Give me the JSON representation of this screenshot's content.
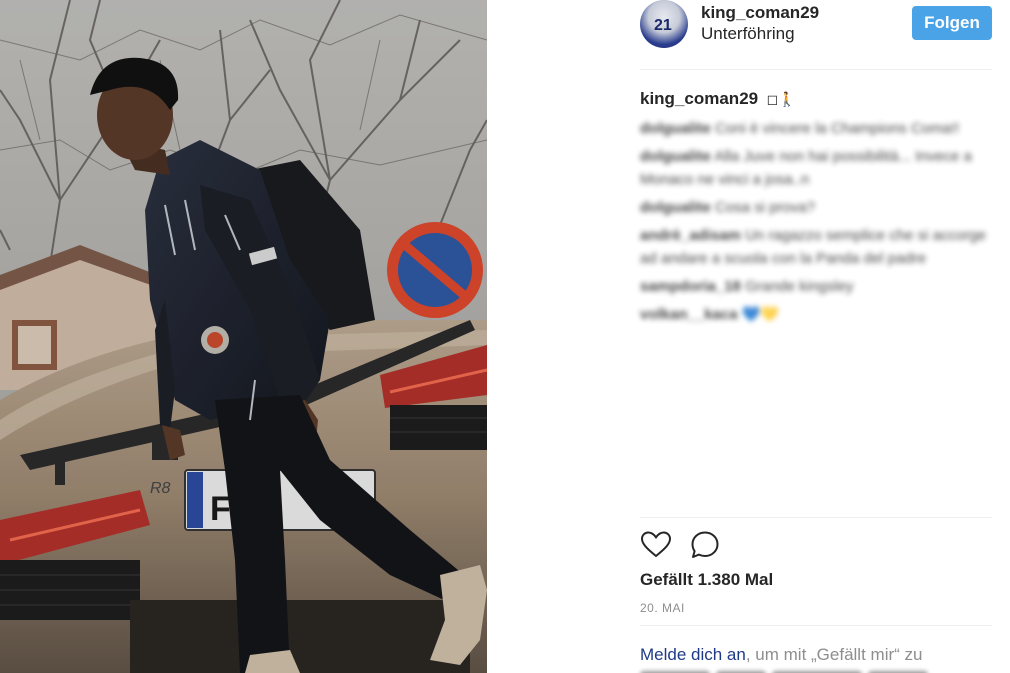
{
  "post": {
    "username": "king_coman29",
    "location": "Unterföhring",
    "follow_label": "Folgen",
    "caption_user": "king_coman29",
    "caption_emoji": "◻🚶"
  },
  "comments": [
    {
      "user": "dolgualite",
      "text": "Coni è vincere la Champions Coma!!"
    },
    {
      "user": "dolgualite",
      "text": "Alla Juve non hai possibilità... Invece a Monaco ne vinci a josa..n"
    },
    {
      "user": "dolgualite",
      "text": "Cosa si prova?"
    },
    {
      "user": "andrè_adisam",
      "text": "Un ragazzo semplice che si accorge ad andare a scuola con la Panda del padre"
    },
    {
      "user": "sampdoria_18",
      "text": "Grande kingsley"
    },
    {
      "user": "volkan__kaca",
      "text": "💙💛"
    }
  ],
  "likes_text": "Gefällt 1.380 Mal",
  "date_text": "20. MAI",
  "login": {
    "link": "Melde dich an",
    "rest": ", um mit „Gefällt mir“ zu"
  },
  "icons": {
    "like": "heart-icon",
    "comment": "comment-bubble-icon"
  },
  "colors": {
    "follow_button": "#4aa3e6",
    "link": "#1f3b86",
    "text": "#262626",
    "muted": "#8e8e8e"
  },
  "photo": {
    "car_badge": "R8",
    "plate_text": "FC"
  }
}
